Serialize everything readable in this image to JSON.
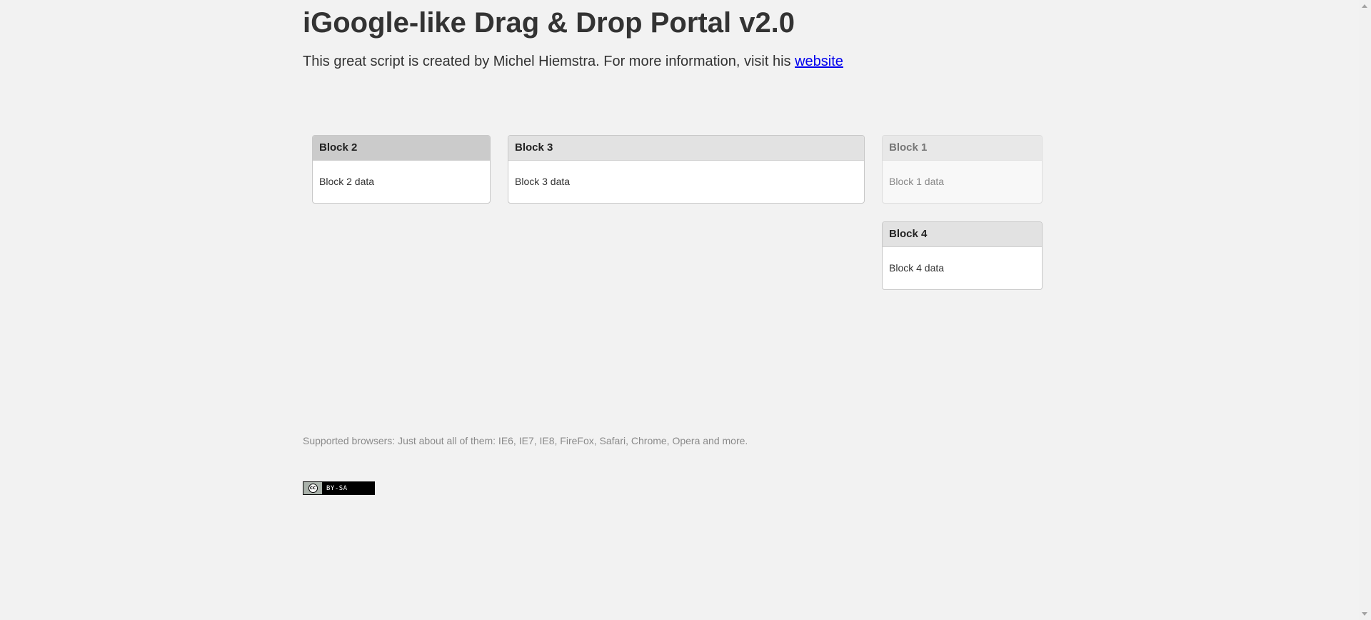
{
  "header": {
    "title": "iGoogle-like Drag & Drop Portal v2.0",
    "intro_text": "This great script is created by Michel Hiemstra. For more information, visit his ",
    "intro_link_label": "website"
  },
  "blocks": [
    {
      "title": "Block 2",
      "body": "Block 2 data",
      "state": "active"
    },
    {
      "title": "Block 3",
      "body": "Block 3 data",
      "state": "normal"
    },
    {
      "title": "Block 1",
      "body": "Block 1 data",
      "state": "faded"
    },
    {
      "title": "Block 4",
      "body": "Block 4 data",
      "state": "normal"
    }
  ],
  "footer": {
    "supported_browsers": "Supported browsers: Just about all of them: IE6, IE7, IE8, FireFox, Safari, Chrome, Opera and more.",
    "license_badge_text": "BY-SA",
    "license_badge_icon": "cc"
  },
  "colors": {
    "link": "#0000ee",
    "page_background": "#f2f2f2"
  }
}
